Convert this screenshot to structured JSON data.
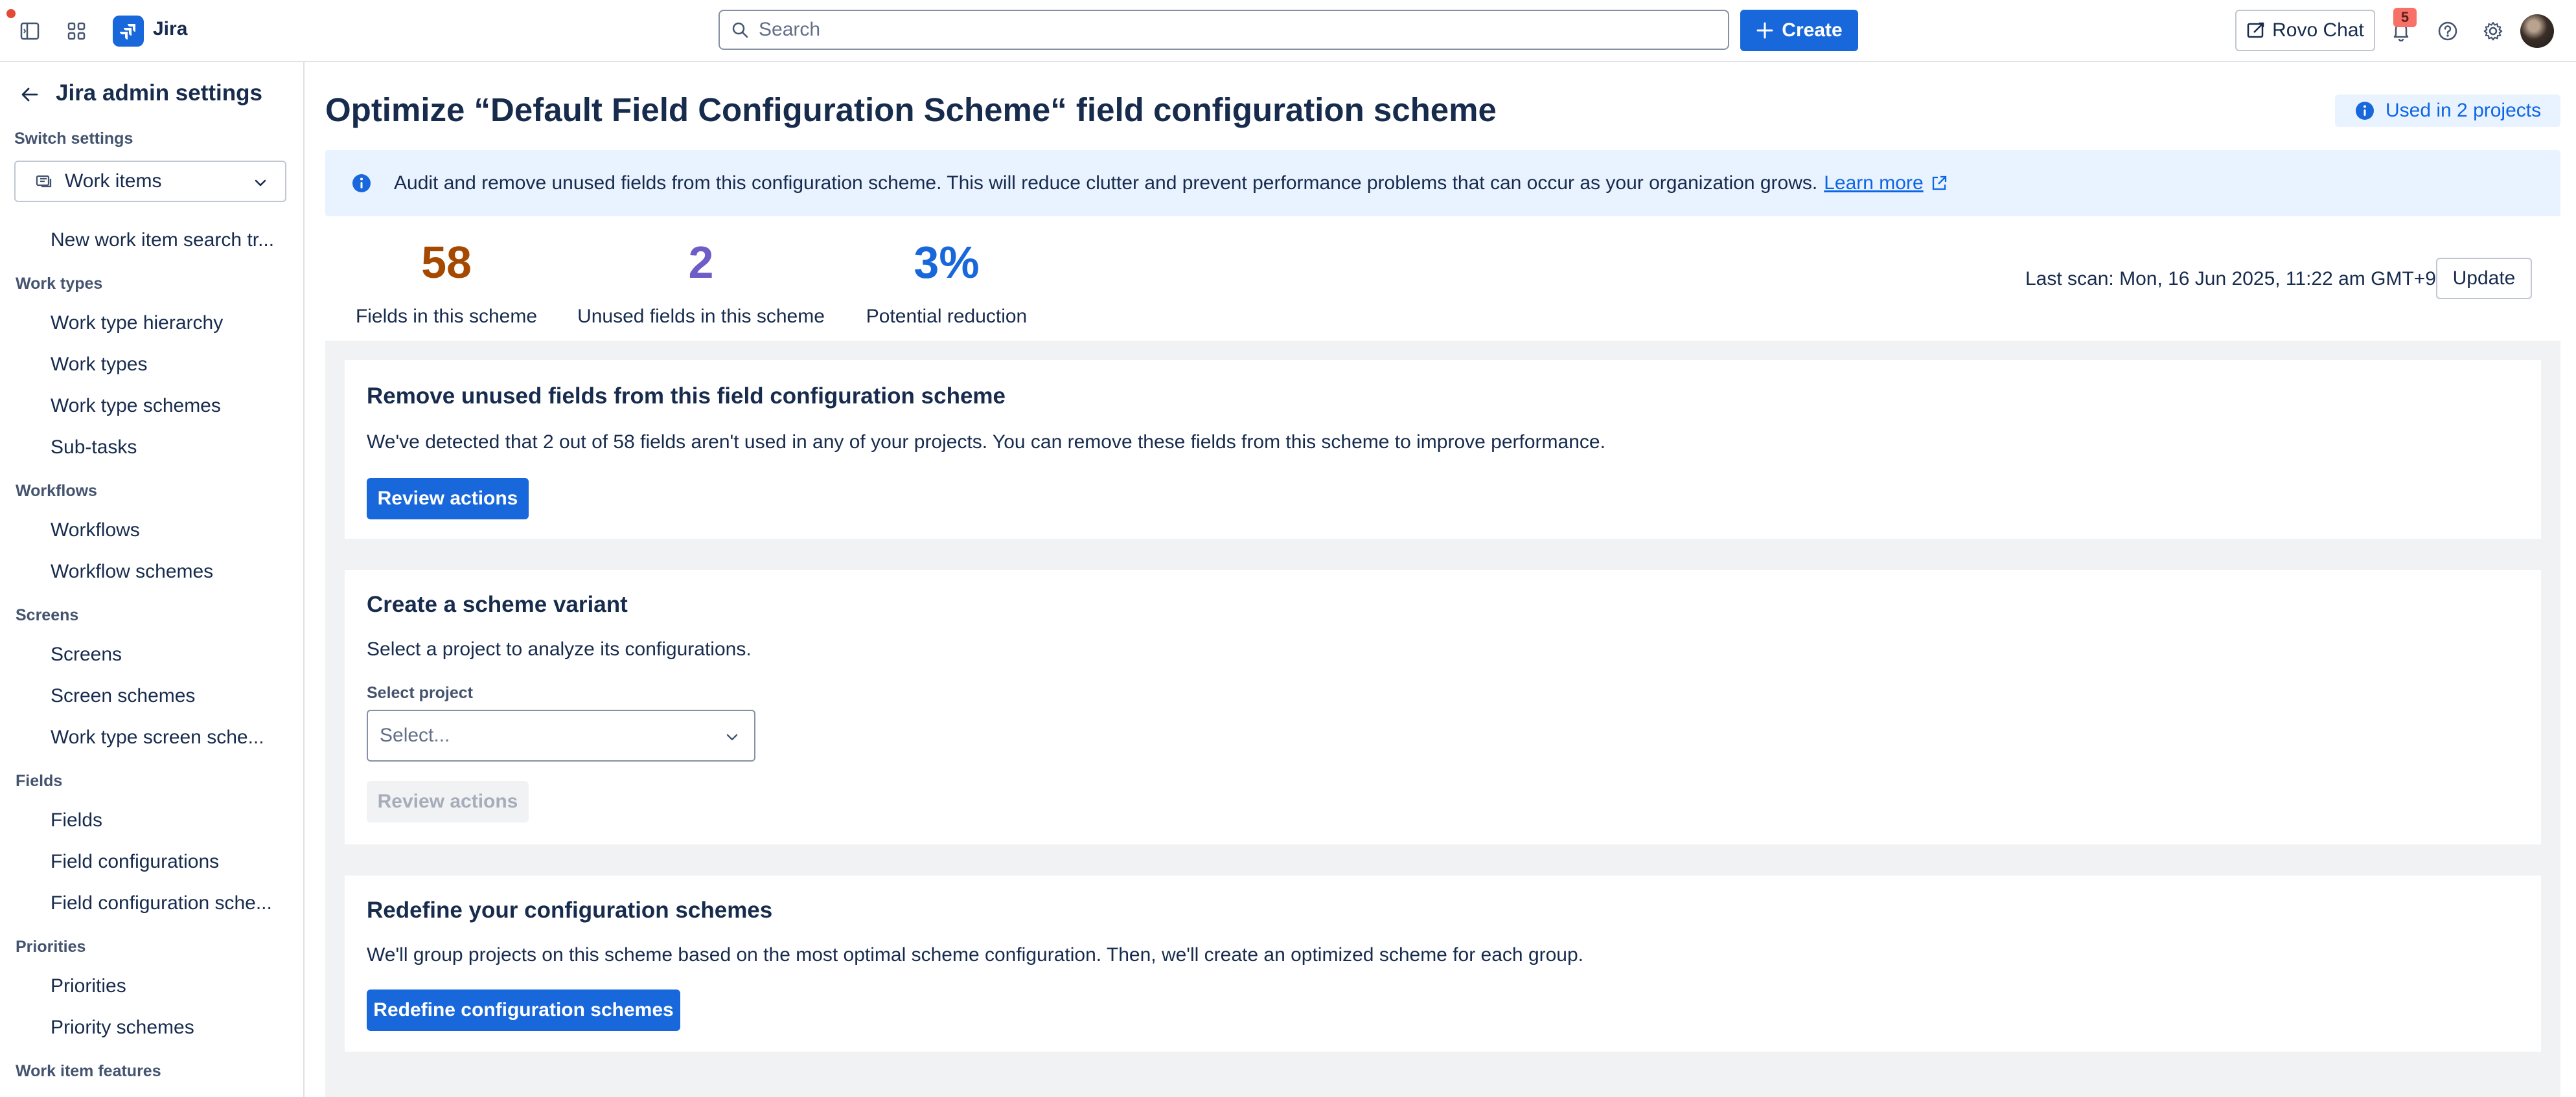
{
  "topbar": {
    "brand": "Jira",
    "search_placeholder": "Search",
    "create_label": "Create",
    "rovo_label": "Rovo Chat",
    "notification_count": "5",
    "icons": [
      "sidebar-toggle-icon",
      "app-switcher-icon",
      "jira-logo-icon",
      "search-icon",
      "plus-icon",
      "rovo-chat-icon",
      "bell-icon",
      "help-icon",
      "gear-icon",
      "avatar"
    ]
  },
  "sidebar": {
    "title": "Jira admin settings",
    "switch_label": "Switch settings",
    "switch_value": "Work items",
    "items": {
      "new_search": "New work item search tr...",
      "group_work_types": "Work types",
      "work_type_hierarchy": "Work type hierarchy",
      "work_types": "Work types",
      "work_type_schemes": "Work type schemes",
      "sub_tasks": "Sub-tasks",
      "group_workflows": "Workflows",
      "workflows": "Workflows",
      "workflow_schemes": "Workflow schemes",
      "group_screens": "Screens",
      "screens": "Screens",
      "screen_schemes": "Screen schemes",
      "work_type_screen_schemes": "Work type screen sche...",
      "group_fields": "Fields",
      "fields": "Fields",
      "field_configurations": "Field configurations",
      "field_configuration_schemes": "Field configuration sche...",
      "group_priorities": "Priorities",
      "priorities": "Priorities",
      "priority_schemes": "Priority schemes",
      "group_work_item_features": "Work item features"
    }
  },
  "main": {
    "title": "Optimize “Default Field Configuration Scheme“ field configuration scheme",
    "used_in": "Used in 2 projects",
    "banner_text": "Audit and remove unused fields from this configuration scheme. This will reduce clutter and prevent performance problems that can occur as your organization grows.",
    "banner_link": "Learn more",
    "stats": [
      {
        "value": "58",
        "label": "Fields in this scheme",
        "color": "#a54800"
      },
      {
        "value": "2",
        "label": "Unused fields in this scheme",
        "color": "#6e5dc6"
      },
      {
        "value": "3%",
        "label": "Potential reduction",
        "color": "#1868db"
      }
    ],
    "last_scan": "Last scan: Mon, 16 Jun 2025, 11:22 am GMT+9",
    "update_label": "Update",
    "cards": {
      "remove": {
        "title": "Remove unused fields from this field configuration scheme",
        "text": "We've detected that 2 out of 58 fields aren't used in any of your projects. You can remove these fields from this scheme to improve performance.",
        "button": "Review actions"
      },
      "variant": {
        "title": "Create a scheme variant",
        "text": "Select a project to analyze its configurations.",
        "select_label": "Select project",
        "select_placeholder": "Select...",
        "button": "Review actions"
      },
      "redefine": {
        "title": "Redefine your configuration schemes",
        "text": "We'll group projects on this scheme based on the most optimal scheme configuration. Then, we'll create an optimized scheme for each group.",
        "button": "Redefine configuration schemes"
      }
    }
  },
  "colors": {
    "primary": "#1868db",
    "banner_bg": "#e9f2ff",
    "page_grey": "#f1f2f4"
  }
}
